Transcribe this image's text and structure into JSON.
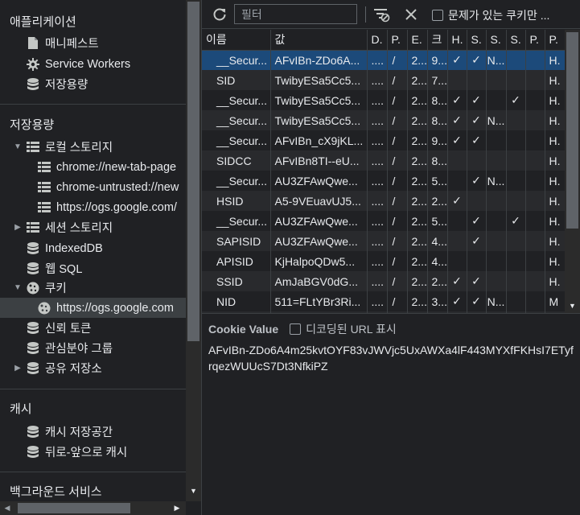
{
  "sidebar": {
    "app_section": {
      "title": "애플리케이션",
      "items": [
        "매니페스트",
        "Service Workers",
        "저장용량"
      ]
    },
    "storage_section": {
      "title": "저장용량",
      "local_storage": {
        "label": "로컬 스토리지",
        "children": [
          "chrome://new-tab-page",
          "chrome-untrusted://new",
          "https://ogs.google.com/"
        ]
      },
      "session_storage": "세션 스토리지",
      "indexeddb": "IndexedDB",
      "websql": "웹 SQL",
      "cookies": {
        "label": "쿠키",
        "children": [
          "https://ogs.google.com"
        ]
      },
      "trust_tokens": "신뢰 토큰",
      "interest_groups": "관심분야 그룹",
      "shared_storage": "공유 저장소"
    },
    "cache_section": {
      "title": "캐시",
      "items": [
        "캐시 저장공간",
        "뒤로-앞으로 캐시"
      ]
    },
    "background_section": {
      "title": "백그라운드 서비스"
    }
  },
  "toolbar": {
    "filter_placeholder": "필터",
    "issues_label": "문제가 있는 쿠키만 ..."
  },
  "table": {
    "columns": [
      "이름",
      "값",
      "D.",
      "P.",
      "E.",
      "크",
      "H.",
      "S.",
      "S.",
      "S.",
      "P.",
      "P."
    ],
    "rows": [
      [
        "__Secur...",
        "AFvIBn-ZDo6A...",
        "....",
        "/",
        "2...",
        "9...",
        "✓",
        "✓",
        "N...",
        "",
        "",
        "H."
      ],
      [
        "SID",
        "TwibyESa5Cc5...",
        "....",
        "/",
        "2...",
        "7...",
        "",
        "",
        "",
        "",
        "",
        "H."
      ],
      [
        "__Secur...",
        "TwibyESa5Cc5...",
        "....",
        "/",
        "2...",
        "8...",
        "✓",
        "✓",
        "",
        "✓",
        "",
        "H."
      ],
      [
        "__Secur...",
        "TwibyESa5Cc5...",
        "....",
        "/",
        "2...",
        "8...",
        "✓",
        "✓",
        "N...",
        "",
        "",
        "H."
      ],
      [
        "__Secur...",
        "AFvIBn_cX9jKL...",
        "....",
        "/",
        "2...",
        "9...",
        "✓",
        "✓",
        "",
        "",
        "",
        "H."
      ],
      [
        "SIDCC",
        "AFvIBn8TI--eU...",
        "....",
        "/",
        "2...",
        "8...",
        "",
        "",
        "",
        "",
        "",
        "H."
      ],
      [
        "__Secur...",
        "AU3ZFAwQwe...",
        "....",
        "/",
        "2...",
        "5...",
        "",
        "✓",
        "N...",
        "",
        "",
        "H."
      ],
      [
        "HSID",
        "A5-9VEuavUJ5...",
        "....",
        "/",
        "2...",
        "2...",
        "✓",
        "",
        "",
        "",
        "",
        "H."
      ],
      [
        "__Secur...",
        "AU3ZFAwQwe...",
        "....",
        "/",
        "2...",
        "5...",
        "",
        "✓",
        "",
        "✓",
        "",
        "H."
      ],
      [
        "SAPISID",
        "AU3ZFAwQwe...",
        "....",
        "/",
        "2...",
        "4...",
        "",
        "✓",
        "",
        "",
        "",
        "H."
      ],
      [
        "APISID",
        "KjHalpoQDw5...",
        "....",
        "/",
        "2...",
        "4...",
        "",
        "",
        "",
        "",
        "",
        "H."
      ],
      [
        "SSID",
        "AmJaBGV0dG...",
        "....",
        "/",
        "2...",
        "2...",
        "✓",
        "✓",
        "",
        "",
        "",
        "H."
      ],
      [
        "NID",
        "511=FLtYBr3Ri...",
        "....",
        "/",
        "2...",
        "3...",
        "✓",
        "✓",
        "N...",
        "",
        "",
        "M"
      ],
      [
        "",
        "",
        "",
        "",
        "",
        "",
        "",
        "",
        "",
        "",
        "",
        ""
      ]
    ]
  },
  "cookie_value": {
    "title": "Cookie Value",
    "decode_label": "디코딩된 URL 표시",
    "value": "AFvIBn-ZDo6A4m25kvtOYF83vJWVjc5UxAWXa4lF443MYXfFKHsI7ETyfrqezWUUcS7Dt3NfkiPZ"
  },
  "colors": {
    "background": "#202124",
    "selected_row": "#1c4a7a",
    "selected_tree": "#3c4043",
    "divider": "#3c4043"
  },
  "icons": {
    "document": "document-icon",
    "gear": "gear-icon",
    "database": "database-icon",
    "grid": "grid-icon",
    "cookie": "cookie-icon",
    "refresh": "refresh-icon",
    "clear_filter": "clear-filter-icon",
    "delete_all": "delete-all-icon"
  }
}
